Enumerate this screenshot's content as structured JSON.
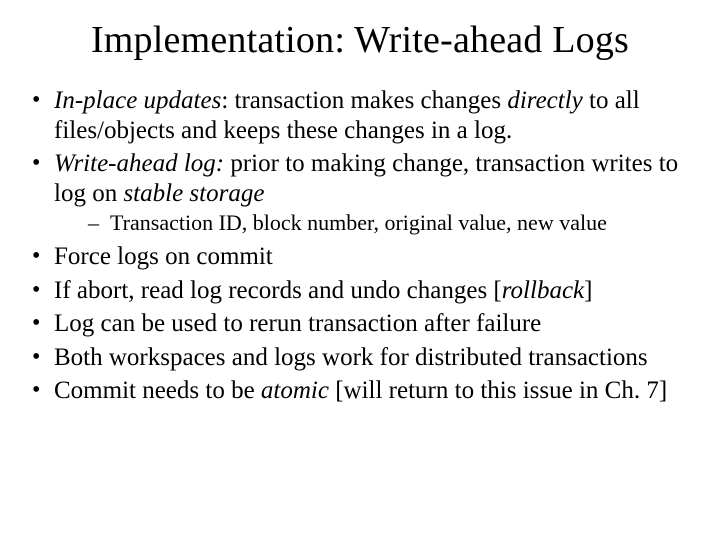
{
  "title": "Implementation: Write-ahead Logs",
  "b1": {
    "t1": "In-place updates",
    "t2": ": transaction makes changes ",
    "t3": "directly",
    "t4": " to all files/objects and keeps these changes in a log."
  },
  "b2": {
    "t1": "Write-ahead log:",
    "t2": " prior to making change, transaction writes to log on ",
    "t3": "stable storage"
  },
  "s1": "Transaction ID, block number, original value, new value",
  "b3": "Force logs on commit",
  "b4": {
    "t1": "If abort, read log records and undo changes [",
    "t2": "rollback",
    "t3": "]"
  },
  "b5": "Log can be used to rerun transaction after failure",
  "b6": "Both workspaces and logs work for distributed transactions",
  "b7": {
    "t1": "Commit needs to be ",
    "t2": "atomic",
    "t3": " [will return to this issue in Ch. 7]"
  }
}
